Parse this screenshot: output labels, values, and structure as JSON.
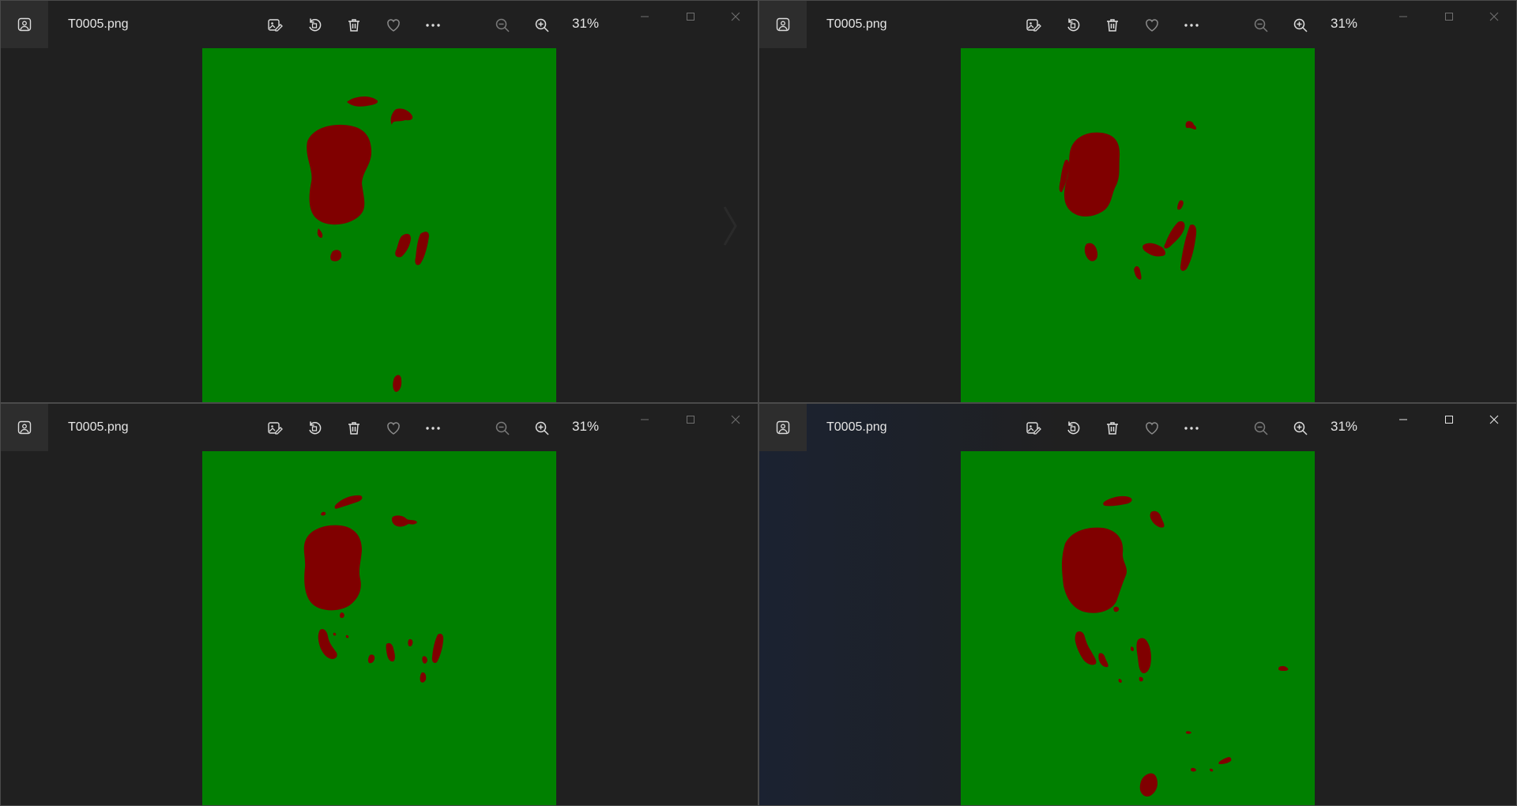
{
  "windows": [
    {
      "filename": "T0005.png",
      "zoom": "31%",
      "active": false
    },
    {
      "filename": "T0005.png",
      "zoom": "31%",
      "active": false
    },
    {
      "filename": "T0005.png",
      "zoom": "31%",
      "active": false
    },
    {
      "filename": "T0005.png",
      "zoom": "31%",
      "active": true
    }
  ],
  "toolbar_icons": [
    "edit-image-icon",
    "rotate-icon",
    "delete-icon",
    "favorite-icon",
    "more-options-icon",
    "zoom-out-icon",
    "zoom-in-icon"
  ],
  "window_controls": [
    "minimize-icon",
    "maximize-icon",
    "close-icon"
  ],
  "colors": {
    "background": "#008000",
    "region": "#800000",
    "window": "#202020",
    "text": "#e6e6e6"
  }
}
